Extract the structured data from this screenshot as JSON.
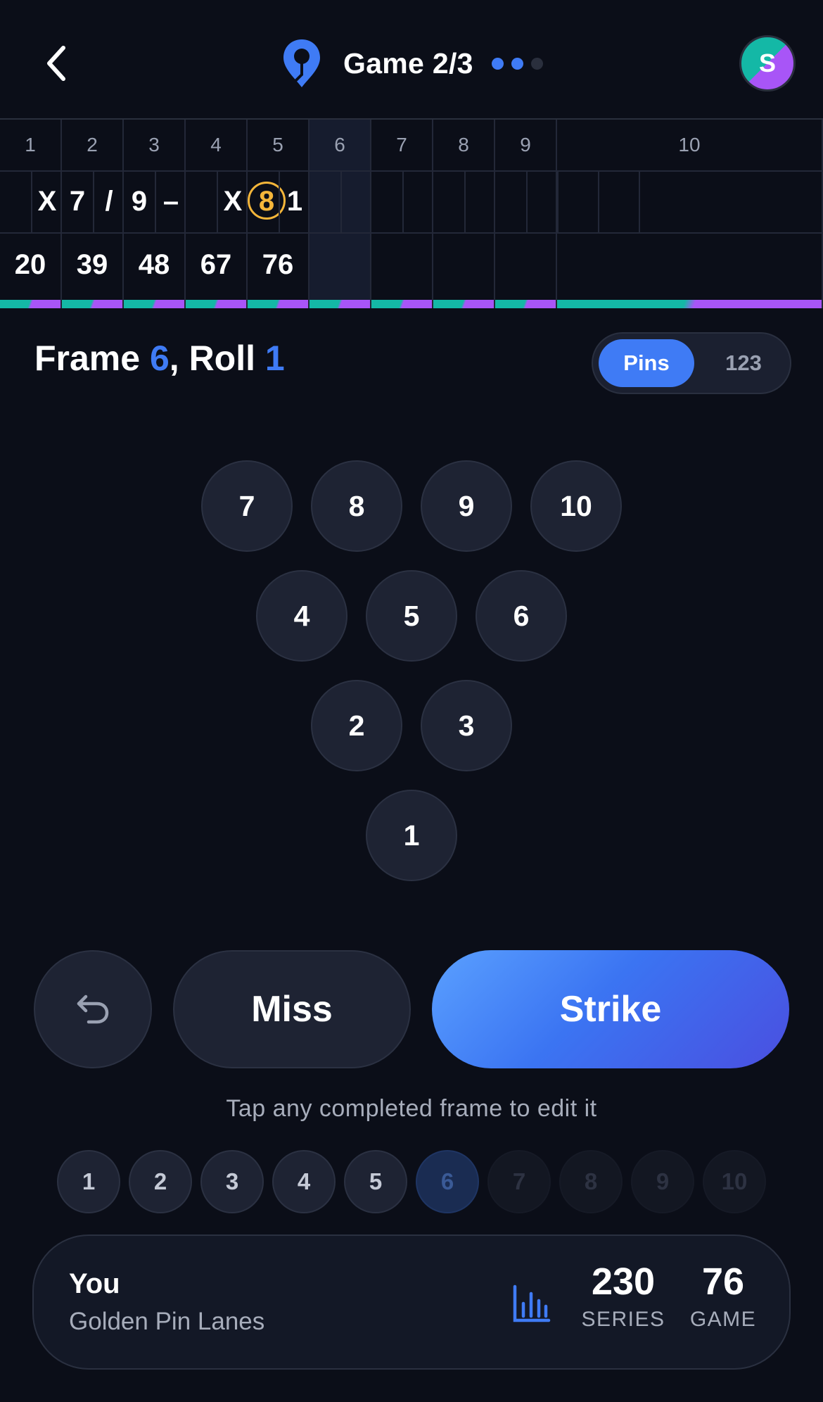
{
  "header": {
    "game_title": "Game 2/3",
    "game_dots": [
      "on",
      "on",
      "off"
    ],
    "avatar_initial": "S",
    "back_icon": "chevron-left-icon",
    "logo_icon": "location-pin-icon"
  },
  "scoreboard": {
    "frames": [
      {
        "number": "1",
        "rolls": [
          "",
          "X"
        ],
        "total": "20"
      },
      {
        "number": "2",
        "rolls": [
          "7",
          "/"
        ],
        "total": "39"
      },
      {
        "number": "3",
        "rolls": [
          "9",
          "–"
        ],
        "total": "48"
      },
      {
        "number": "4",
        "rolls": [
          "",
          "X"
        ],
        "total": "67"
      },
      {
        "number": "5",
        "rolls": [
          "8",
          "1"
        ],
        "total": "76",
        "split_roll": 0
      },
      {
        "number": "6",
        "rolls": [
          "",
          ""
        ],
        "total": "",
        "current": true
      },
      {
        "number": "7",
        "rolls": [
          "",
          ""
        ],
        "total": ""
      },
      {
        "number": "8",
        "rolls": [
          "",
          ""
        ],
        "total": ""
      },
      {
        "number": "9",
        "rolls": [
          "",
          ""
        ],
        "total": ""
      },
      {
        "number": "10",
        "rolls": [
          "",
          "",
          ""
        ],
        "total": ""
      }
    ]
  },
  "entry": {
    "frame_label": "Frame ",
    "frame_value": "6",
    "roll_label": ", Roll ",
    "roll_value": "1",
    "mode_pins": "Pins",
    "mode_numbers": "123"
  },
  "pins": [
    "7",
    "8",
    "9",
    "10",
    "4",
    "5",
    "6",
    "2",
    "3",
    "1"
  ],
  "actions": {
    "undo_icon": "undo-icon",
    "miss_label": "Miss",
    "strike_label": "Strike"
  },
  "hint": "Tap any completed frame to edit it",
  "frame_nav": [
    {
      "label": "1",
      "state": "done"
    },
    {
      "label": "2",
      "state": "done"
    },
    {
      "label": "3",
      "state": "done"
    },
    {
      "label": "4",
      "state": "done"
    },
    {
      "label": "5",
      "state": "done"
    },
    {
      "label": "6",
      "state": "current"
    },
    {
      "label": "7",
      "state": "todo"
    },
    {
      "label": "8",
      "state": "todo"
    },
    {
      "label": "9",
      "state": "todo"
    },
    {
      "label": "10",
      "state": "todo"
    }
  ],
  "card": {
    "player": "You",
    "venue": "Golden Pin Lanes",
    "stats_icon": "bar-chart-icon",
    "series_value": "230",
    "series_label": "SERIES",
    "game_value": "76",
    "game_label": "GAME"
  },
  "colors": {
    "background": "#0b0e18",
    "accent": "#3f7bf5",
    "split_ring": "#f5b63a",
    "teal": "#14b8a6",
    "purple": "#a855f7"
  }
}
